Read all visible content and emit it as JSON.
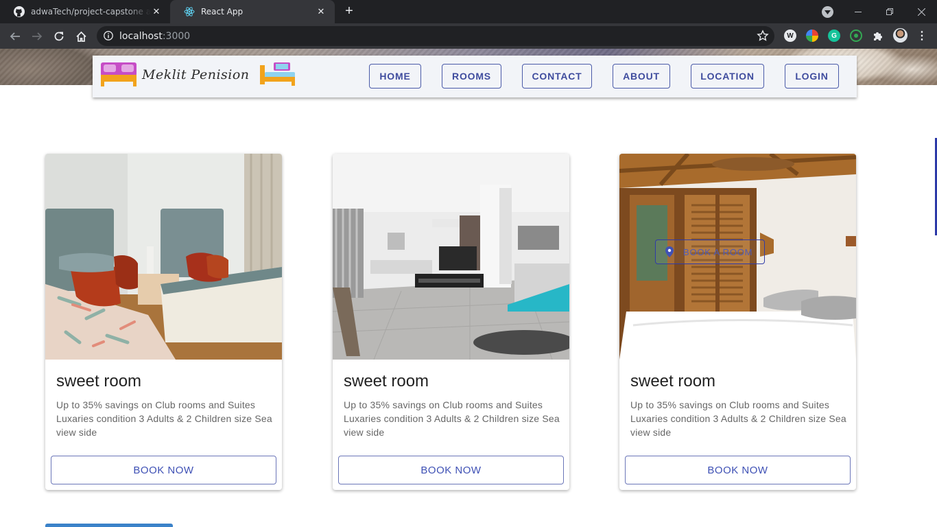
{
  "browser": {
    "tabs": [
      {
        "title": "adwaTech/project-capstone at ne",
        "icon": "github-icon",
        "active": false
      },
      {
        "title": "React App",
        "icon": "react-icon",
        "active": true
      }
    ],
    "url_host": "localhost",
    "url_port": ":3000"
  },
  "site": {
    "brand": "Meklit Penision",
    "nav": [
      "HOME",
      "ROOMS",
      "CONTACT",
      "ABOUT",
      "LOCATION",
      "LOGIN"
    ]
  },
  "rooms": [
    {
      "title": "sweet room",
      "description": "Up to 35% savings on Club rooms and Suites Luxaries condition 3 Adults & 2 Children size Sea view side",
      "button": "BOOK NOW"
    },
    {
      "title": "sweet room",
      "description": "Up to 35% savings on Club rooms and Suites Luxaries condition 3 Adults & 2 Children size Sea view side",
      "button": "BOOK NOW"
    },
    {
      "title": "sweet room",
      "description": "Up to 35% savings on Club rooms and Suites Luxaries condition 3 Adults & 2 Children size Sea view side",
      "button": "BOOK NOW"
    }
  ],
  "overlay_button": "BOOK A ROOM",
  "colors": {
    "accent": "#3f51b5",
    "navbar_bg": "#f2f4f8",
    "chrome_dark": "#202124"
  }
}
